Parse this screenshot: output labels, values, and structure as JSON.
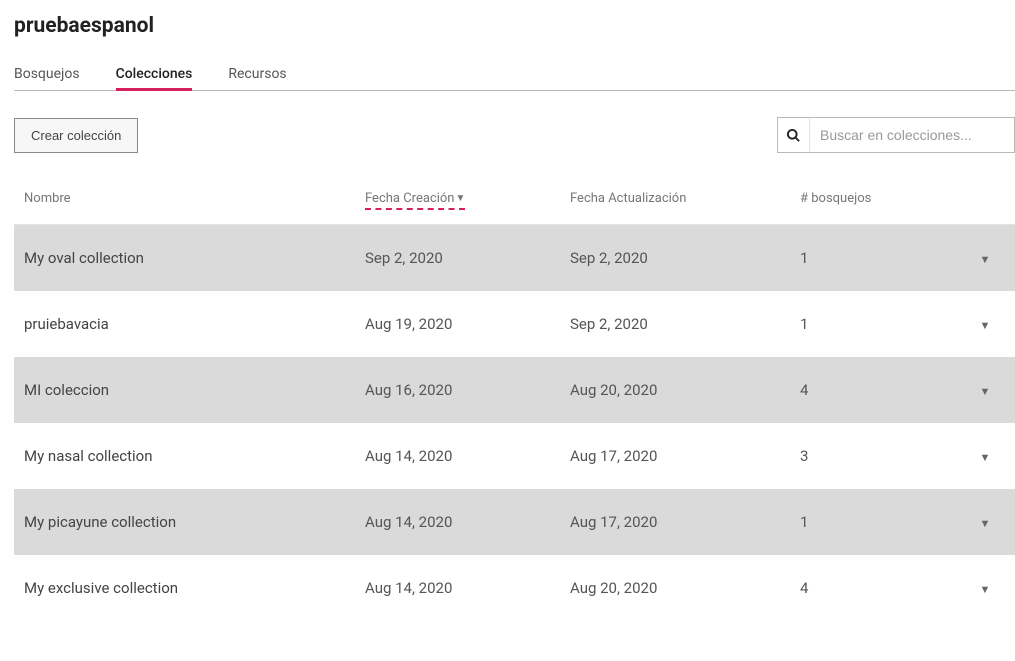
{
  "page": {
    "title": "pruebaespanol"
  },
  "tabs": {
    "items": [
      {
        "label": "Bosquejos",
        "active": false
      },
      {
        "label": "Colecciones",
        "active": true
      },
      {
        "label": "Recursos",
        "active": false
      }
    ]
  },
  "toolbar": {
    "create_label": "Crear colección",
    "search_placeholder": "Buscar en colecciones..."
  },
  "table": {
    "headers": {
      "name": "Nombre",
      "created": "Fecha Creación",
      "updated": "Fecha Actualización",
      "count": "# bosquejos",
      "sort_by": "created",
      "sort_dir_glyph": "▼"
    },
    "rows": [
      {
        "name": "My oval collection",
        "created": "Sep 2, 2020",
        "updated": "Sep 2, 2020",
        "count": "1"
      },
      {
        "name": "pruiebavacia",
        "created": "Aug 19, 2020",
        "updated": "Sep 2, 2020",
        "count": "1"
      },
      {
        "name": "MI coleccion",
        "created": "Aug 16, 2020",
        "updated": "Aug 20, 2020",
        "count": "4"
      },
      {
        "name": "My nasal collection",
        "created": "Aug 14, 2020",
        "updated": "Aug 17, 2020",
        "count": "3"
      },
      {
        "name": "My picayune collection",
        "created": "Aug 14, 2020",
        "updated": "Aug 17, 2020",
        "count": "1"
      },
      {
        "name": "My exclusive collection",
        "created": "Aug 14, 2020",
        "updated": "Aug 20, 2020",
        "count": "4"
      }
    ]
  }
}
